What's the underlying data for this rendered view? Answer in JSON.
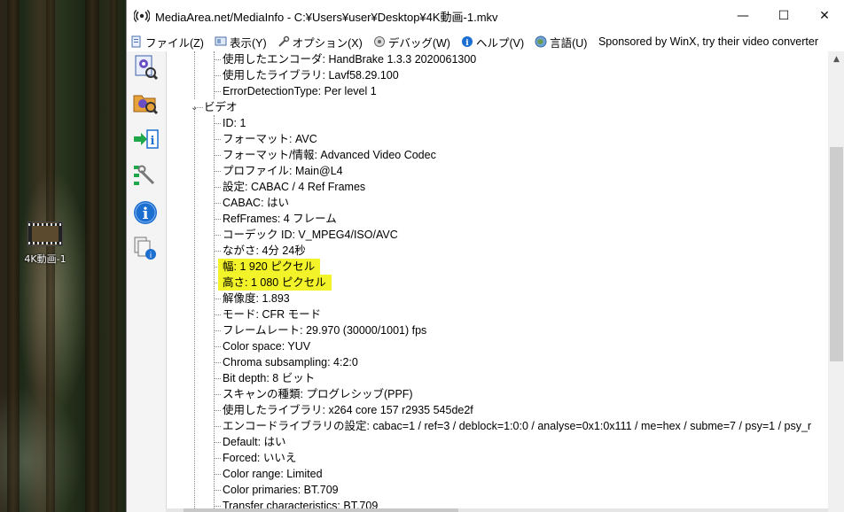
{
  "window": {
    "title": "MediaArea.net/MediaInfo - C:¥Users¥user¥Desktop¥4K動画-1.mkv",
    "controls": {
      "minimize": "—",
      "maximize": "☐",
      "close": "✕"
    }
  },
  "menubar": {
    "items": [
      {
        "label": "ファイル(Z)",
        "icon": "file-icon"
      },
      {
        "label": "表示(Y)",
        "icon": "view-icon"
      },
      {
        "label": "オプション(X)",
        "icon": "options-icon"
      },
      {
        "label": "デバッグ(W)",
        "icon": "debug-icon"
      },
      {
        "label": "ヘルプ(V)",
        "icon": "help-icon"
      },
      {
        "label": "言語(U)",
        "icon": "language-icon"
      }
    ],
    "sponsor": "Sponsored by WinX, try their video converter"
  },
  "toolbar": {
    "buttons": [
      "open-file-icon",
      "open-folder-icon",
      "export-icon",
      "preferences-icon",
      "info-icon",
      "donate-icon"
    ]
  },
  "desktop": {
    "icon_label": "4K動画-1"
  },
  "tree": {
    "general_tail": [
      "使用したエンコーダ: HandBrake 1.3.3 2020061300",
      "使用したライブラリ: Lavf58.29.100",
      "ErrorDetectionType: Per level 1"
    ],
    "video_section": "ビデオ",
    "video_items": [
      "ID: 1",
      "フォーマット: AVC",
      "フォーマット/情報: Advanced Video Codec",
      "プロファイル: Main@L4",
      "設定: CABAC / 4 Ref Frames",
      "CABAC: はい",
      "RefFrames: 4 フレーム",
      "コーデック ID: V_MPEG4/ISO/AVC",
      "ながさ: 4分 24秒",
      "幅: 1 920 ピクセル",
      "高さ: 1 080 ピクセル",
      "解像度: 1.893",
      "モード: CFR モード",
      "フレームレート: 29.970 (30000/1001) fps",
      "Color space: YUV",
      "Chroma subsampling: 4:2:0",
      "Bit depth: 8 ビット",
      "スキャンの種類: プログレシッブ(PPF)",
      "使用したライブラリ: x264 core 157 r2935 545de2f",
      "エンコードライブラリの設定: cabac=1 / ref=3 / deblock=1:0:0 / analyse=0x1:0x111 / me=hex / subme=7 / psy=1 / psy_r",
      "Default: はい",
      "Forced: いいえ",
      "Color range: Limited",
      "Color primaries: BT.709",
      "Transfer characteristics: BT.709"
    ],
    "highlight_color": "#f3f32a"
  },
  "colors": {
    "accent_blue": "#1c6fd1",
    "window_bg": "#ffffff"
  }
}
